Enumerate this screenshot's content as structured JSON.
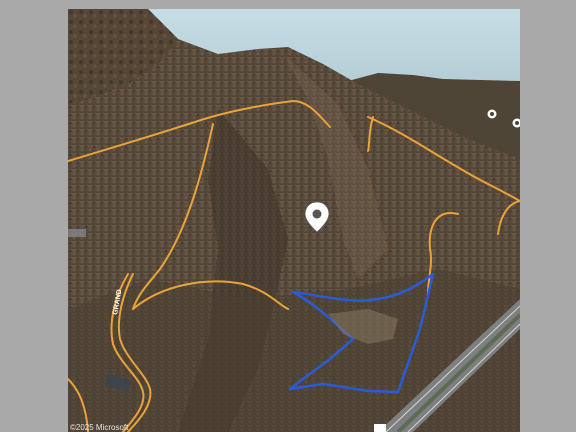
{
  "map": {
    "view": "3D satellite terrain",
    "road_label": "GRAND",
    "pin_icon": "location-pin-icon",
    "poi_icons": [
      "poi-marker-icon",
      "poi-marker-icon"
    ],
    "parcel_outline_color": "#2a5bd7",
    "road_color": "#e8a33a",
    "attribution": "©2025 Microsoft"
  }
}
